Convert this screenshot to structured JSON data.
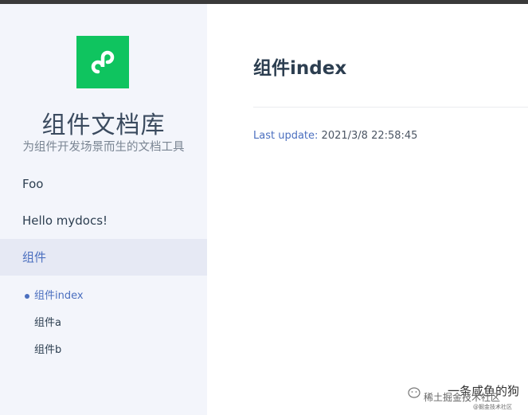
{
  "site": {
    "title": "组件文档库",
    "subtitle": "为组件开发场景而生的文档工具",
    "logo_icon": "mini-program-icon",
    "logo_color": "#0fc45f"
  },
  "nav": {
    "items": [
      {
        "label": "Foo"
      },
      {
        "label": "Hello mydocs!"
      },
      {
        "label": "组件"
      }
    ],
    "sub_items": [
      {
        "label": "组件index"
      },
      {
        "label": "组件a"
      },
      {
        "label": "组件b"
      }
    ]
  },
  "page": {
    "title": "组件index",
    "last_update_label": "Last update:",
    "last_update_value": "2021/3/8 22:58:45"
  },
  "watermark": {
    "main": "一条咸鱼的狗",
    "sub": "稀土掘金技术社区",
    "sub_small": "@掘金技术社区"
  },
  "colors": {
    "accent": "#4b6fbf",
    "text": "#2c3e50",
    "sidebar_bg": "#f3f5fb"
  }
}
